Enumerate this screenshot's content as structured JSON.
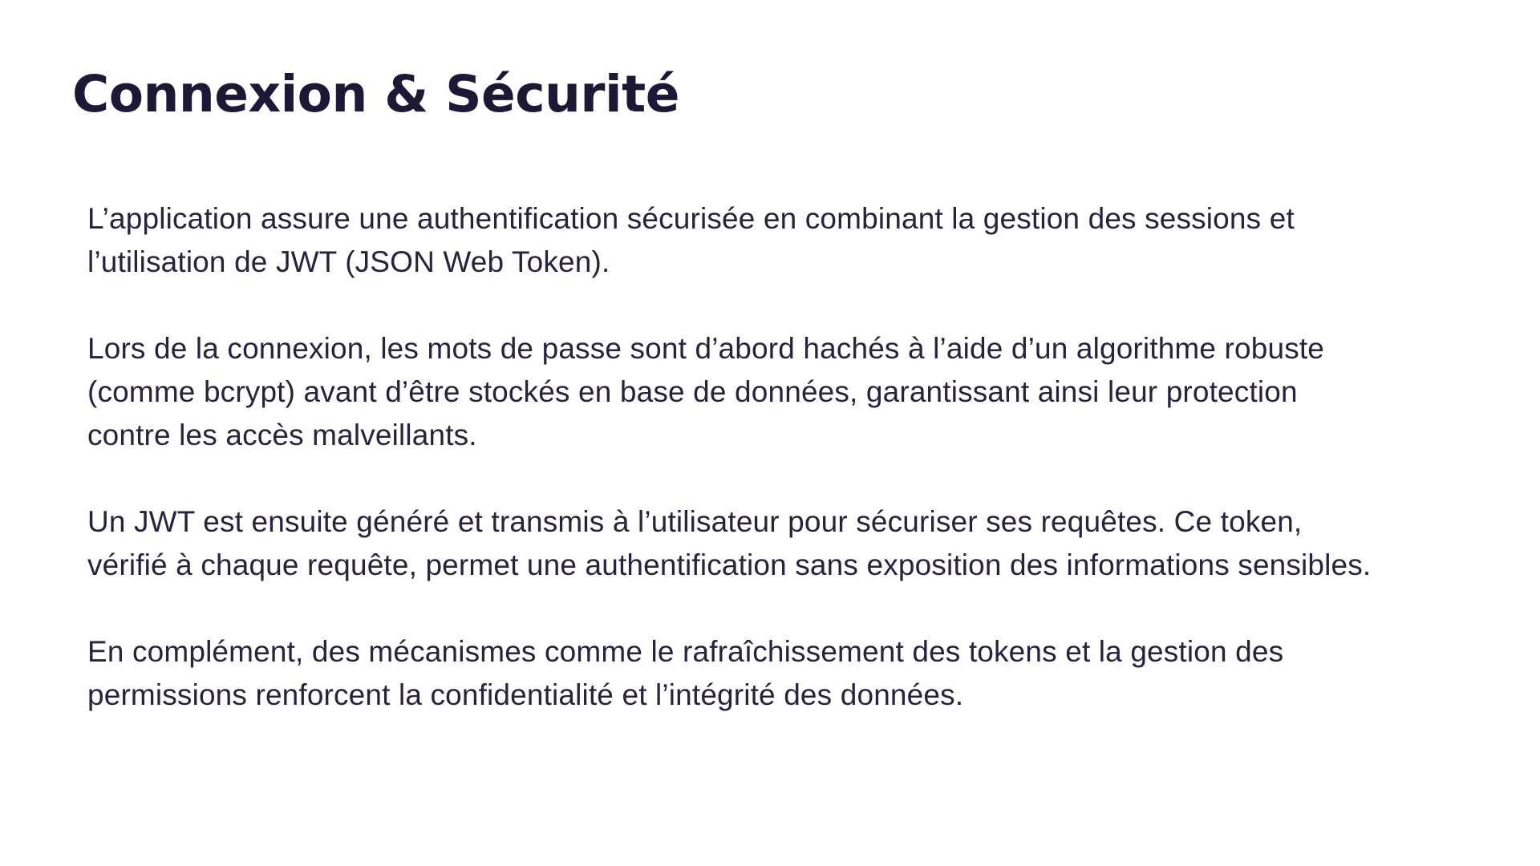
{
  "slide": {
    "title": "Connexion & Sécurité",
    "paragraphs": [
      {
        "lines": [
          "L’application assure une authentification sécurisée en combinant la gestion des sessions et",
          "l’utilisation de JWT (JSON Web Token)."
        ]
      },
      {
        "lines": [
          "Lors de la connexion, les mots de passe sont d’abord hachés à l’aide d’un algorithme robuste",
          "(comme bcrypt) avant d’être stockés en base de données, garantissant ainsi leur protection",
          "contre les accès malveillants."
        ]
      },
      {
        "lines": [
          "Un JWT est ensuite généré et transmis à l’utilisateur pour sécuriser ses requêtes. Ce token,",
          "vérifié à chaque requête, permet une authentification sans exposition des informations sensibles."
        ]
      },
      {
        "lines": [
          "En complément, des mécanismes comme le rafraîchissement des tokens et la gestion des",
          "permissions renforcent la confidentialité et l’intégrité des données."
        ]
      }
    ]
  },
  "colors": {
    "background": "#ffffff",
    "title": "#1c1836",
    "body_text": "#26233d"
  }
}
